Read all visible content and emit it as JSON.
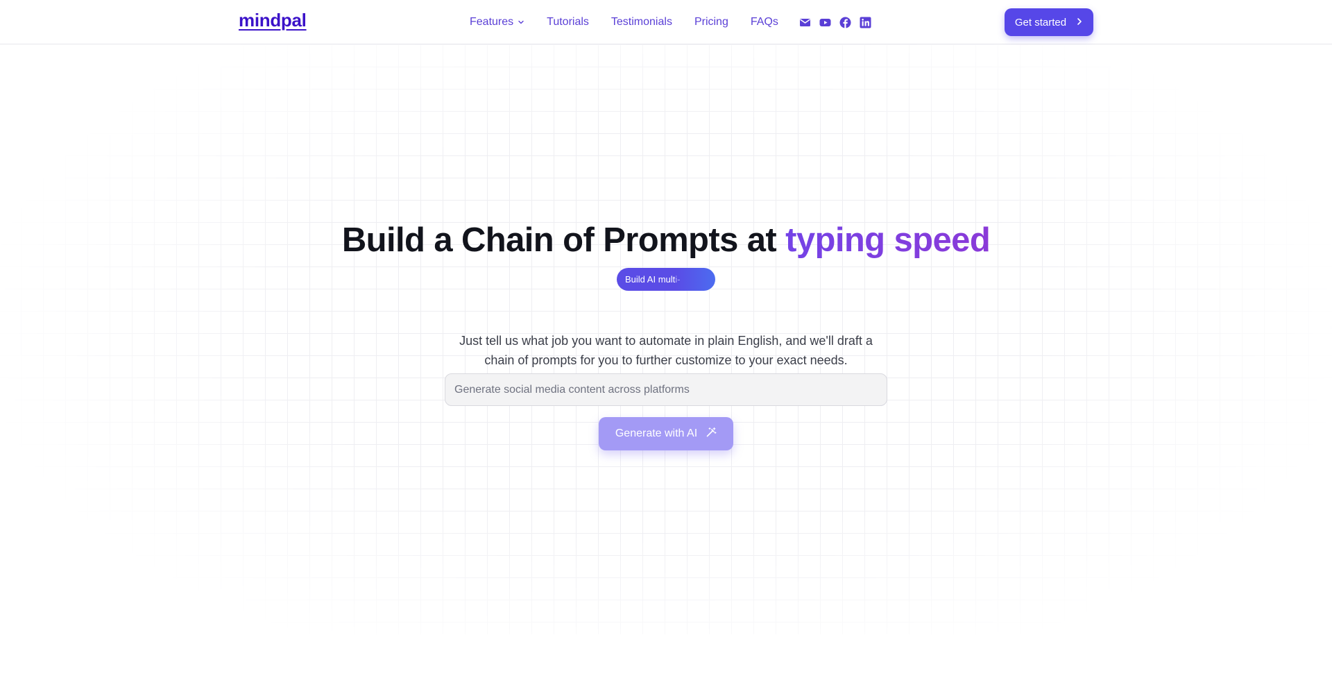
{
  "brand": {
    "logo_text": "mindpal",
    "logo_color": "#3b12c9"
  },
  "nav": {
    "items": [
      {
        "label": "Features",
        "has_dropdown": true
      },
      {
        "label": "Tutorials"
      },
      {
        "label": "Testimonials"
      },
      {
        "label": "Pricing"
      },
      {
        "label": "FAQs"
      }
    ],
    "social_icons": [
      "mail-icon",
      "youtube-icon",
      "facebook-icon",
      "linkedin-icon"
    ],
    "cta_label": "Get started"
  },
  "hero": {
    "title_main": "Build a Chain of Prompts at ",
    "title_accent": "typing speed",
    "pill_text": "Build AI mult",
    "pill_text_fade": "i-",
    "description": "Just tell us what job you want to automate in plain English, and we'll draft a chain of prompts for you to further customize to your exact needs.",
    "input_placeholder": "Generate social media content across platforms",
    "generate_label": "Generate with AI"
  },
  "colors": {
    "accent": "#5647e8",
    "nav_text": "#5a3fd6",
    "title_gradient_start": "#7443e6",
    "title_gradient_end": "#8a3ad8",
    "generate_button": "#a39af5"
  }
}
